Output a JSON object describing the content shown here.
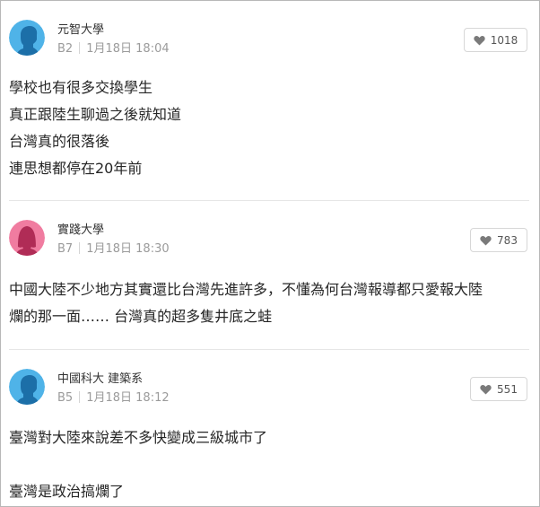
{
  "comments": [
    {
      "school": "元智大學",
      "floor": "B2",
      "date": "1月18日 18:04",
      "likes": "1018",
      "avatar_gender": "male",
      "avatar_color": "#4fb3e8",
      "lines": [
        "學校也有很多交換學生",
        "真正跟陸生聊過之後就知道",
        "台灣真的很落後",
        "連思想都停在20年前"
      ]
    },
    {
      "school": "實踐大學",
      "floor": "B7",
      "date": "1月18日 18:30",
      "likes": "783",
      "avatar_gender": "female",
      "avatar_color": "#f07ca0",
      "lines": [
        "中國大陸不少地方其實還比台灣先進許多，不懂為何台灣報導都只愛報大陸",
        "爛的那一面…… 台灣真的超多隻井底之蛙"
      ]
    },
    {
      "school": "中國科大 建築系",
      "floor": "B5",
      "date": "1月18日 18:12",
      "likes": "551",
      "avatar_gender": "male",
      "avatar_color": "#4fb3e8",
      "lines": [
        "臺灣對大陸來說差不多快變成三級城市了",
        "",
        "臺灣是政治搞爛了"
      ]
    }
  ],
  "icons": {
    "like": "heart-icon",
    "avatar_male": "male-avatar-icon",
    "avatar_female": "female-avatar-icon"
  }
}
